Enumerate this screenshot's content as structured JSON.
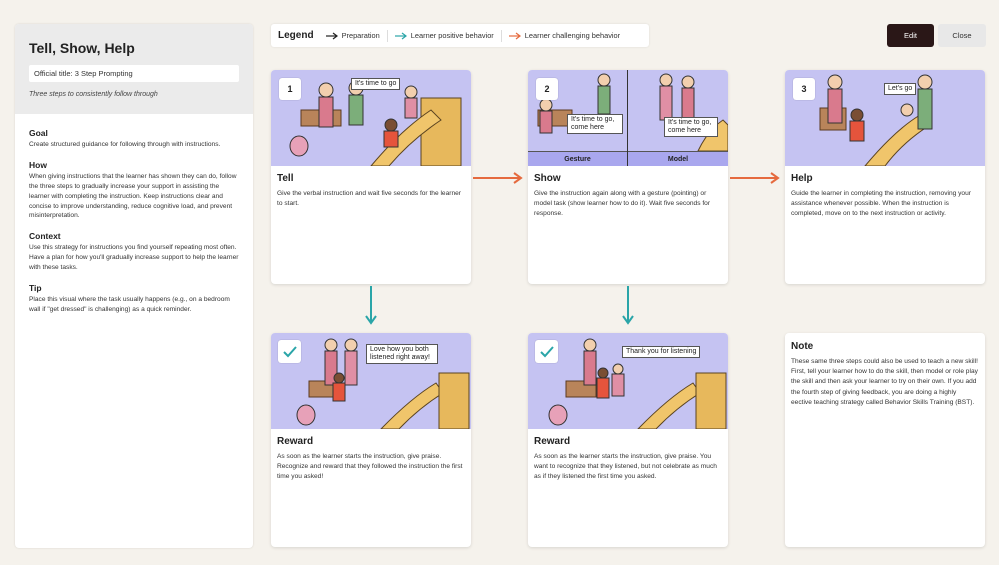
{
  "sidebar": {
    "title": "Tell, Show, Help",
    "official_title": "Official title: 3 Step Prompting",
    "subtitle": "Three steps to consistently follow through",
    "sections": [
      {
        "heading": "Goal",
        "text": "Create structured guidance for following through with instructions."
      },
      {
        "heading": "How",
        "text": "When giving instructions that the learner has shown they can do, follow the three steps to gradually increase your support in assisting the learner with completing the instruction. Keep instructions clear and concise to improve understanding, reduce cognitive load, and prevent misinterpretation."
      },
      {
        "heading": "Context",
        "text": "Use this strategy for instructions you find yourself repeating most often. Have a plan for how you'll gradually increase support to help the learner with these tasks."
      },
      {
        "heading": "Tip",
        "text": "Place this visual where the task usually happens (e.g., on a bedroom wall if \"get dressed\" is challenging) as a quick reminder."
      }
    ]
  },
  "legend": {
    "title": "Legend",
    "items": [
      {
        "label": "Preparation",
        "color": "#222222"
      },
      {
        "label": "Learner positive behavior",
        "color": "#2aa5a8"
      },
      {
        "label": "Learner challenging behavior",
        "color": "#e56a3e"
      }
    ]
  },
  "toolbar": {
    "edit_label": "Edit",
    "close_label": "Close"
  },
  "cards": {
    "tell": {
      "step": "1",
      "bubble": "It's time to go",
      "title": "Tell",
      "text": "Give the verbal instruction and wait five seconds for the learner to start."
    },
    "show": {
      "step": "2",
      "bubble_left": "It's time to go, come here",
      "bubble_right": "It's time to go, come here",
      "label_left": "Gesture",
      "label_right": "Model",
      "title": "Show",
      "text": "Give the instruction again along with a gesture (pointing) or model task (show learner how to do it). Wait five seconds for response."
    },
    "help": {
      "step": "3",
      "bubble": "Let's go",
      "title": "Help",
      "text": "Guide the learner in completing the instruction, removing your assistance whenever possible. When the instruction is completed, move on to the next instruction or activity."
    },
    "reward1": {
      "bubble": "Love how you both listened right away!",
      "title": "Reward",
      "text": "As soon as the learner starts the instruction, give praise. Recognize and reward that they followed the instruction the first time you asked!"
    },
    "reward2": {
      "bubble": "Thank you for listening",
      "title": "Reward",
      "text": "As soon as the learner starts the instruction, give praise. You want to recognize that they listened, but not celebrate as much as if they listened the first time you asked."
    },
    "note": {
      "title": "Note",
      "text": "These same three steps could also be used to teach a new skill! First, tell your learner how to do the skill, then model or role play the skill and then ask your learner to try on their own. If you add the fourth step of giving feedback, you are doing a highly eective teaching strategy called Behavior Skills Training (BST)."
    }
  },
  "colors": {
    "illustration_bg": "#c5c3f2",
    "edit_button": "#2a1717",
    "positive_arrow": "#2aa5a8",
    "challenging_arrow": "#e56a3e"
  }
}
